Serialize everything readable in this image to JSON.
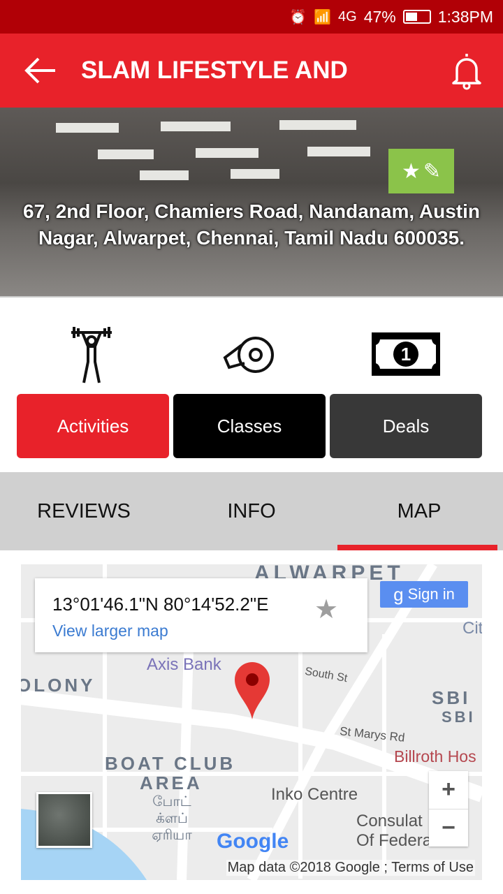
{
  "status_bar": {
    "battery": "47%",
    "time": "1:38PM",
    "network": "4G"
  },
  "app_bar": {
    "title": "SLAM LIFESTYLE AND"
  },
  "hero": {
    "address": "67, 2nd Floor, Chamiers Road, Nandanam, Austin Nagar, Alwarpet, Chennai, Tamil Nadu 600035."
  },
  "actions": [
    {
      "label": "Activities",
      "color": "#e8222a"
    },
    {
      "label": "Classes",
      "color": "#000000"
    },
    {
      "label": "Deals",
      "color": "#383838"
    }
  ],
  "tabs": [
    {
      "label": "REVIEWS"
    },
    {
      "label": "INFO"
    },
    {
      "label": "MAP",
      "active": true
    }
  ],
  "map": {
    "coords": "13°01'46.1\"N 80°14'52.2\"E",
    "view_larger": "View larger map",
    "sign_in": "Sign in",
    "zoom_in": "+",
    "zoom_out": "−",
    "attribution": "Map data ©2018 Google",
    "terms": "Terms of Use",
    "logo": "Google",
    "labels": {
      "alwarpet": "ALWARPET",
      "colony": "OLONY",
      "axis": "Axis Bank",
      "south": "South St",
      "stmarys": "St Marys Rd",
      "sbi": "SBI",
      "sbi2": "SBI",
      "billroth": "Billroth Hos",
      "boat": "BOAT CLUB",
      "area": "AREA",
      "tamil": "போட் க்ளப் ஏரியா",
      "inko": "Inko Centre",
      "consul": "Consulat",
      "federal": "Of Federa",
      "cit": "Cit"
    }
  }
}
